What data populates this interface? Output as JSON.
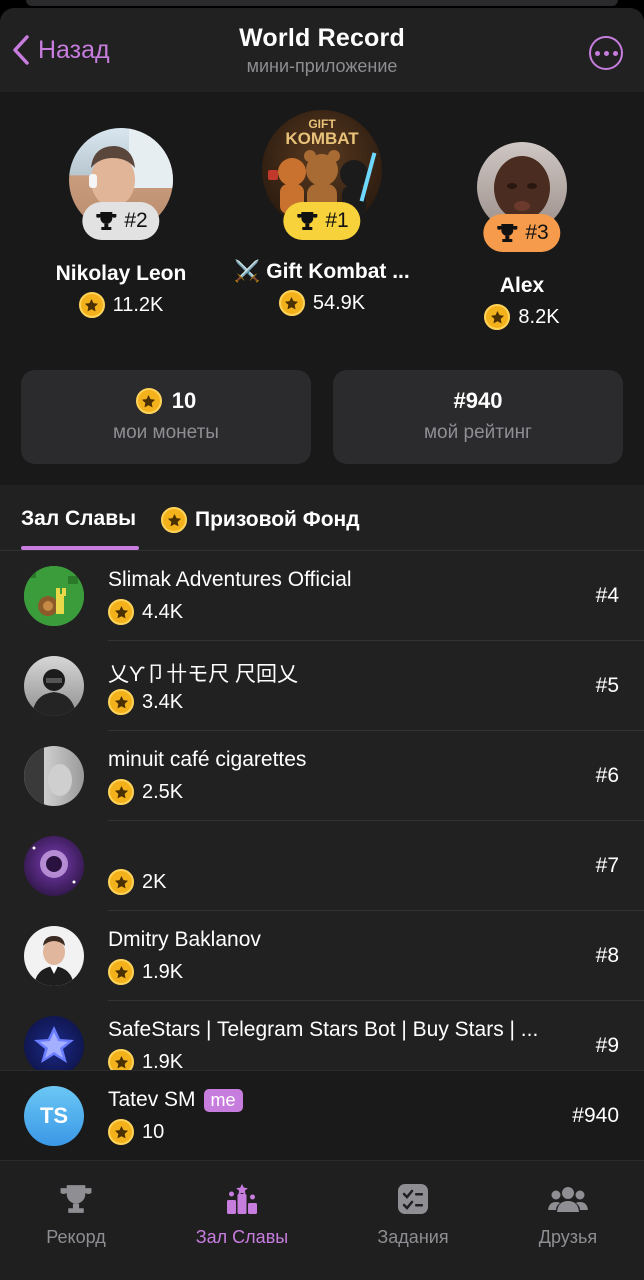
{
  "header": {
    "back_label": "Назад",
    "title": "World Record",
    "subtitle": "мини-приложение"
  },
  "podium": [
    {
      "name": "Nikolay Leon",
      "rank": "#2",
      "score": "11.2K",
      "pill_color": "#e2e2e2"
    },
    {
      "name": "⚔️ Gift Kombat ...",
      "rank": "#1",
      "score": "54.9K",
      "pill_color": "#f7d23a",
      "logo_text": "GIFT KOMBAT"
    },
    {
      "name": "Alex",
      "rank": "#3",
      "score": "8.2K",
      "pill_color": "#f59b4b"
    }
  ],
  "stats": {
    "coins_value": "10",
    "coins_label": "мои монеты",
    "rating_value": "#940",
    "rating_label": "мой рейтинг"
  },
  "tabs": {
    "hall_of_fame": "Зал Славы",
    "prize_fund": "Призовой Фонд"
  },
  "list": [
    {
      "name": "Slimak Adventures Official",
      "score": "4.4K",
      "rank": "#4"
    },
    {
      "name": "乂Ƴ卩卄モ尺 尺回乂",
      "score": "3.4K",
      "rank": "#5"
    },
    {
      "name": "minuit café cigarettes",
      "score": "2.5K",
      "rank": "#6"
    },
    {
      "name": "",
      "score": "2K",
      "rank": "#7"
    },
    {
      "name": "Dmitry Baklanov",
      "score": "1.9K",
      "rank": "#8"
    },
    {
      "name": "SafeStars | Telegram Stars Bot | Buy Stars | ...",
      "score": "1.9K",
      "rank": "#9"
    }
  ],
  "me": {
    "initials": "TS",
    "name": "Tatev SM",
    "badge": "me",
    "score": "10",
    "rank": "#940"
  },
  "nav": {
    "record": "Рекорд",
    "hall": "Зал Славы",
    "tasks": "Задания",
    "friends": "Друзья"
  },
  "colors": {
    "accent": "#c77dde",
    "coin": "#f3b21b"
  }
}
